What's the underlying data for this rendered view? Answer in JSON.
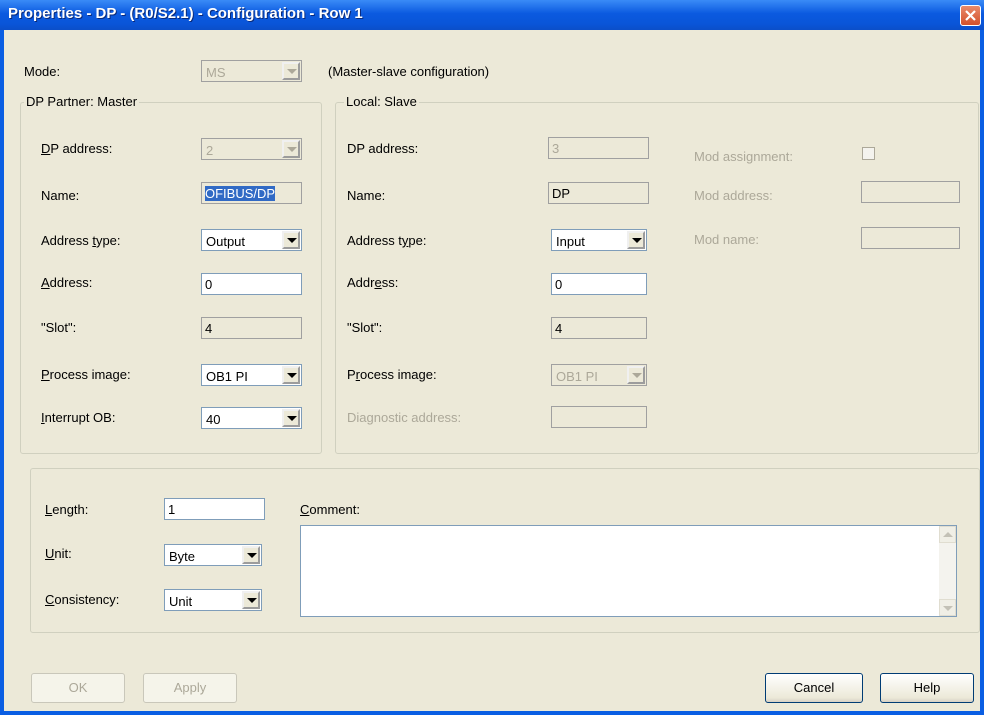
{
  "window": {
    "title": "Properties - DP - (R0/S2.1) - Configuration - Row 1"
  },
  "mode": {
    "label": "Mode:",
    "value": "MS",
    "description": "(Master-slave configuration)"
  },
  "master": {
    "group_label": "DP Partner: Master",
    "dp_address": {
      "label_u": "D",
      "label_rest": "P address:",
      "value": "2"
    },
    "name": {
      "label": "Name:",
      "value": "OFIBUS/DP"
    },
    "address_type": {
      "label_pre": "Address ",
      "label_u": "t",
      "label_rest": "ype:",
      "value": "Output"
    },
    "address": {
      "label_u": "A",
      "label_rest": "ddress:",
      "value": "0"
    },
    "slot": {
      "label": "\"Slot\":",
      "value": "4"
    },
    "process_image": {
      "label_u": "P",
      "label_rest": "rocess image:",
      "value": "OB1 PI"
    },
    "interrupt_ob": {
      "label_u": "I",
      "label_rest": "nterrupt OB:",
      "value": "40"
    }
  },
  "slave": {
    "group_label": "Local: Slave",
    "dp_address": {
      "label": "DP address:",
      "value": "3"
    },
    "name": {
      "label": "Name:",
      "value": "DP"
    },
    "address_type": {
      "label_pre": "Address t",
      "label_u": "y",
      "label_rest": "pe:",
      "value": "Input"
    },
    "address": {
      "label_pre": "Addr",
      "label_u": "e",
      "label_rest": "ss:",
      "value": "0"
    },
    "slot": {
      "label": "\"Slot\":",
      "value": "4"
    },
    "process_image": {
      "label_pre": "P",
      "label_u": "r",
      "label_rest": "ocess image:",
      "value": "OB1 PI"
    },
    "diagnostic_address": {
      "label": "Diagnostic address:",
      "value": ""
    },
    "mod_assignment": {
      "label": "Mod assignment:"
    },
    "mod_address": {
      "label": "Mod address:",
      "value": ""
    },
    "mod_name": {
      "label": "Mod name:",
      "value": ""
    }
  },
  "bottom": {
    "length": {
      "label_u": "L",
      "label_rest": "ength:",
      "value": "1"
    },
    "unit": {
      "label_u": "U",
      "label_rest": "nit:",
      "value": "Byte"
    },
    "consistency": {
      "label_u": "C",
      "label_rest": "onsistency:",
      "value": "Unit"
    },
    "comment": {
      "label_u": "C",
      "label_rest": "omment:",
      "value": ""
    }
  },
  "buttons": {
    "ok": "OK",
    "apply": "Apply",
    "cancel": "Cancel",
    "help": "Help"
  }
}
